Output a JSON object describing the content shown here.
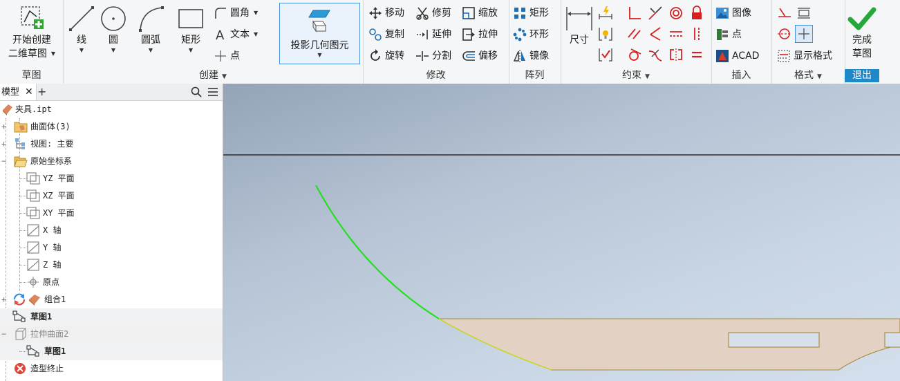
{
  "ribbon": {
    "sketch_group": {
      "label": "草图",
      "start_line1": "开始创建",
      "start_line2": "二维草图"
    },
    "create_group": {
      "label": "创建",
      "line": "线",
      "circle": "圆",
      "arc": "圆弧",
      "rect": "矩形",
      "fillet": "圆角",
      "text": "文本",
      "point": "点"
    },
    "project": {
      "label": "投影几何图元"
    },
    "modify_group": {
      "label": "修改",
      "move": "移动",
      "copy": "复制",
      "rotate": "旋转",
      "trim": "修剪",
      "extend": "延伸",
      "split": "分割",
      "scale": "缩放",
      "stretch": "拉伸",
      "offset": "偏移"
    },
    "pattern_group": {
      "label": "阵列",
      "rect": "矩形",
      "circular": "环形",
      "mirror": "镜像"
    },
    "constrain_group": {
      "label": "约束",
      "dimension": "尺寸"
    },
    "insert_group": {
      "label": "插入",
      "image": "图像",
      "points": "点",
      "acad": "ACAD"
    },
    "format_group": {
      "label": "格式",
      "show_format": "显示格式"
    },
    "exit_group": {
      "label": "退出",
      "finish_line1": "完成",
      "finish_line2": "草图"
    }
  },
  "browser": {
    "tab": "模型",
    "tree": [
      {
        "label": "夹具.ipt"
      },
      {
        "label": "曲面体(3)"
      },
      {
        "label": "视图: 主要"
      },
      {
        "label": "原始坐标系"
      },
      {
        "label": "YZ 平面"
      },
      {
        "label": "XZ 平面"
      },
      {
        "label": "XY 平面"
      },
      {
        "label": "X 轴"
      },
      {
        "label": "Y 轴"
      },
      {
        "label": "Z 轴"
      },
      {
        "label": "原点"
      },
      {
        "label": "组合1"
      },
      {
        "label": "草图1"
      },
      {
        "label": "拉伸曲面2"
      },
      {
        "label": "草图1"
      },
      {
        "label": "造型终止"
      }
    ]
  },
  "colors": {
    "accent": "#1e88c9",
    "sketch_curve": "#22e01e",
    "part_fill": "#e3d2c3",
    "part_edge": "#a58a3c"
  }
}
